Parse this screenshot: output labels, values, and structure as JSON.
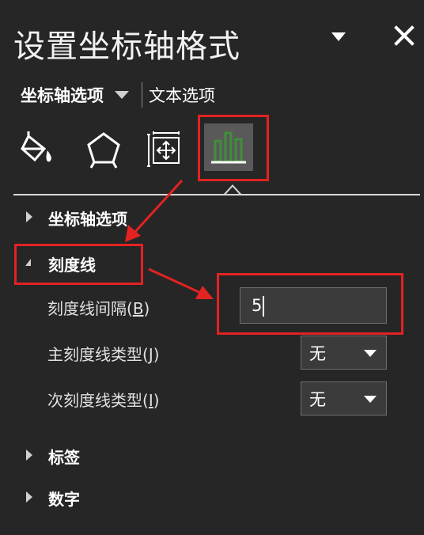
{
  "pane": {
    "title": "设置坐标轴格式",
    "menu_icon": "chevron-down-icon",
    "close_icon": "close-icon"
  },
  "tabs": {
    "axis_options": "坐标轴选项",
    "text_options": "文本选项"
  },
  "category_icons": [
    "fill-line-icon",
    "effects-pentagon-icon",
    "size-properties-icon",
    "axis-options-bar-chart-icon"
  ],
  "sections": {
    "axis_options": "坐标轴选项",
    "tick_marks": "刻度线",
    "labels": "标签",
    "number": "数字"
  },
  "tick_marks": {
    "interval_label": "刻度线间隔(",
    "interval_key": "B",
    "interval_label_end": ")",
    "interval_value": "5",
    "major_type_label": "主刻度线类型(",
    "major_type_key": "J",
    "major_type_label_end": ")",
    "major_type_value": "无",
    "minor_type_label": "次刻度线类型(",
    "minor_type_key": "I",
    "minor_type_label_end": ")",
    "minor_type_value": "无"
  },
  "colors": {
    "background": "#262626",
    "annotation_red": "#e32222",
    "selected_icon_bg": "#595959",
    "chart_icon_green": "#3f8f3a"
  }
}
